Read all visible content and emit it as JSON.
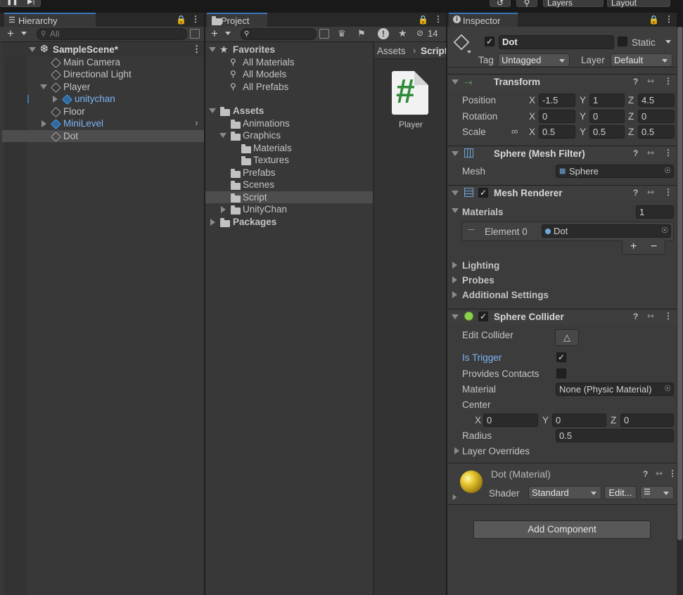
{
  "topbar": {
    "undo_icon": "history-icon",
    "search_icon": "search-icon",
    "layers_label": "Layers",
    "layout_label": "Layout"
  },
  "hierarchy": {
    "tab_label": "Hierarchy",
    "search_placeholder": "All",
    "scene_name": "SampleScene*",
    "items": [
      {
        "label": "Main Camera"
      },
      {
        "label": "Directional Light"
      },
      {
        "label": "Player"
      },
      {
        "label": "unitychan"
      },
      {
        "label": "Floor"
      },
      {
        "label": "MiniLevel"
      },
      {
        "label": "Dot"
      }
    ]
  },
  "project": {
    "tab_label": "Project",
    "hidden_count": "14",
    "favorites_label": "Favorites",
    "favorites": [
      "All Materials",
      "All Models",
      "All Prefabs"
    ],
    "assets_label": "Assets",
    "folders": [
      "Animations",
      "Graphics",
      "Materials",
      "Textures",
      "Prefabs",
      "Scenes",
      "Script",
      "UnityChan"
    ],
    "packages_label": "Packages",
    "breadcrumb": [
      "Assets",
      "Script"
    ],
    "asset_file": {
      "name": "Player",
      "glyph": "#"
    }
  },
  "inspector": {
    "tab_label": "Inspector",
    "object_name": "Dot",
    "static_label": "Static",
    "tag_label": "Tag",
    "tag_value": "Untagged",
    "layer_label": "Layer",
    "layer_value": "Default",
    "transform": {
      "title": "Transform",
      "position_label": "Position",
      "rotation_label": "Rotation",
      "scale_label": "Scale",
      "position": {
        "x": "-1.5",
        "y": "1",
        "z": "4.5"
      },
      "rotation": {
        "x": "0",
        "y": "0",
        "z": "0"
      },
      "scale": {
        "x": "0.5",
        "y": "0.5",
        "z": "0.5"
      }
    },
    "mesh_filter": {
      "title": "Sphere (Mesh Filter)",
      "mesh_label": "Mesh",
      "mesh_value": "Sphere"
    },
    "mesh_renderer": {
      "title": "Mesh Renderer",
      "materials_label": "Materials",
      "materials_count": "1",
      "element_label": "Element 0",
      "element_value": "Dot",
      "add_symbol": "+",
      "remove_symbol": "−",
      "lighting_label": "Lighting",
      "probes_label": "Probes",
      "additional_label": "Additional Settings"
    },
    "sphere_collider": {
      "title": "Sphere Collider",
      "edit_collider_label": "Edit Collider",
      "is_trigger_label": "Is Trigger",
      "provides_contacts_label": "Provides Contacts",
      "material_label": "Material",
      "material_value": "None (Physic Material)",
      "center_label": "Center",
      "center": {
        "x": "0",
        "y": "0",
        "z": "0"
      },
      "radius_label": "Radius",
      "radius_value": "0.5",
      "layer_overrides_label": "Layer Overrides"
    },
    "material": {
      "title": "Dot (Material)",
      "shader_label": "Shader",
      "shader_value": "Standard",
      "edit_label": "Edit...",
      "list_icon": "list-icon"
    },
    "add_component_label": "Add Component",
    "axes": {
      "x": "X",
      "y": "Y",
      "z": "Z"
    }
  },
  "colors": {
    "accent": "#3a79bb",
    "prefab_blue": "#7cb4f4",
    "selection": "#4d4d4d",
    "panel": "#383838"
  }
}
